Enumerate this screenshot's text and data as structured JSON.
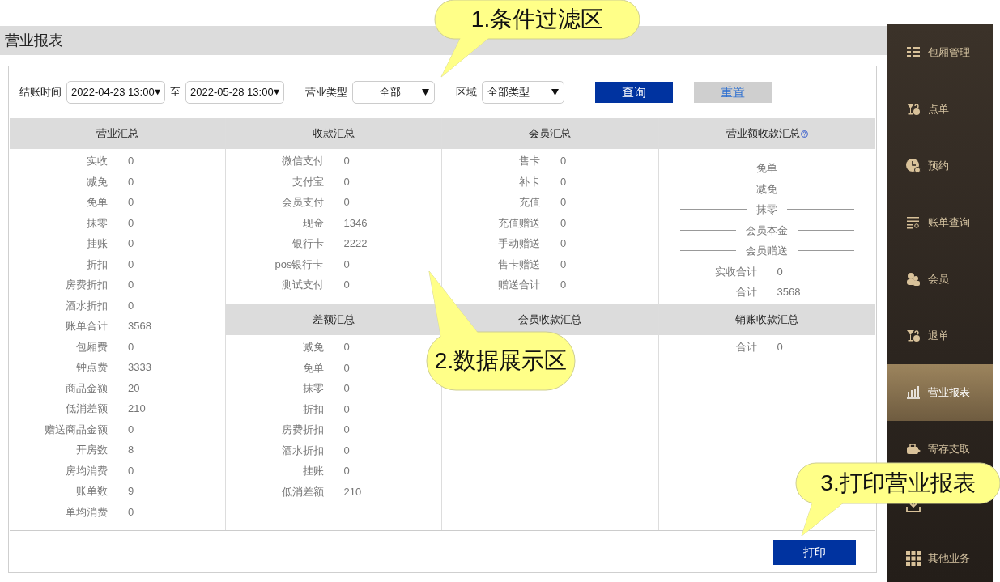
{
  "page_title": "营业报表",
  "filters": {
    "time_label": "结账时间",
    "start": "2022-04-23 13:00",
    "to_label": "至",
    "end": "2022-05-28 13:00",
    "type_label": "营业类型",
    "type_value": "全部",
    "area_label": "区域",
    "area_value": "全部类型",
    "query_button": "查询",
    "reset_button": "重置"
  },
  "summary": {
    "title": "营业汇总",
    "rows": [
      {
        "label": "实收",
        "value": "0"
      },
      {
        "label": "减免",
        "value": "0"
      },
      {
        "label": "免单",
        "value": "0"
      },
      {
        "label": "抹零",
        "value": "0"
      },
      {
        "label": "挂账",
        "value": "0"
      },
      {
        "label": "折扣",
        "value": "0"
      },
      {
        "label": "房费折扣",
        "value": "0"
      },
      {
        "label": "酒水折扣",
        "value": "0"
      },
      {
        "label": "账单合计",
        "value": "3568"
      },
      {
        "label": "包厢费",
        "value": "0"
      },
      {
        "label": "钟点费",
        "value": "3333"
      },
      {
        "label": "商品金额",
        "value": "20"
      },
      {
        "label": "低消差额",
        "value": "210"
      },
      {
        "label": "赠送商品金额",
        "value": "0"
      },
      {
        "label": "开房数",
        "value": "8"
      },
      {
        "label": "房均消费",
        "value": "0"
      },
      {
        "label": "账单数",
        "value": "9"
      },
      {
        "label": "单均消费",
        "value": "0"
      }
    ]
  },
  "upper_panels": [
    {
      "title": "收款汇总",
      "help_icon": false,
      "rows": [
        {
          "kind": "row",
          "label": "微信支付",
          "value": "0"
        },
        {
          "kind": "row",
          "label": "支付宝",
          "value": "0"
        },
        {
          "kind": "row",
          "label": "会员支付",
          "value": "0"
        },
        {
          "kind": "row",
          "label": "现金",
          "value": "1346"
        },
        {
          "kind": "row",
          "label": "银行卡",
          "value": "2222"
        },
        {
          "kind": "row",
          "label": "pos银行卡",
          "value": "0"
        },
        {
          "kind": "row",
          "label": "测试支付",
          "value": "0"
        }
      ]
    },
    {
      "title": "会员汇总",
      "help_icon": false,
      "rows": [
        {
          "kind": "row",
          "label": "售卡",
          "value": "0"
        },
        {
          "kind": "row",
          "label": "补卡",
          "value": "0"
        },
        {
          "kind": "row",
          "label": "充值",
          "value": "0"
        },
        {
          "kind": "row",
          "label": "充值赠送",
          "value": "0"
        },
        {
          "kind": "row",
          "label": "手动赠送",
          "value": "0"
        },
        {
          "kind": "row",
          "label": "售卡赠送",
          "value": "0"
        },
        {
          "kind": "row",
          "label": "赠送合计",
          "value": "0"
        }
      ]
    },
    {
      "title": "营业额收款汇总",
      "help_icon": true,
      "rows": [
        {
          "kind": "divider",
          "label": "免单"
        },
        {
          "kind": "divider",
          "label": "减免"
        },
        {
          "kind": "divider",
          "label": "抹零"
        },
        {
          "kind": "divider",
          "label": "会员本金"
        },
        {
          "kind": "divider",
          "label": "会员赠送"
        },
        {
          "kind": "row",
          "label": "实收合计",
          "value": "0"
        },
        {
          "kind": "row",
          "label": "合计",
          "value": "3568"
        }
      ]
    }
  ],
  "lower_panels": [
    {
      "title": "差额汇总",
      "rows": [
        {
          "label": "减免",
          "value": "0"
        },
        {
          "label": "免单",
          "value": "0"
        },
        {
          "label": "抹零",
          "value": "0"
        },
        {
          "label": "折扣",
          "value": "0"
        },
        {
          "label": "房费折扣",
          "value": "0"
        },
        {
          "label": "酒水折扣",
          "value": "0"
        },
        {
          "label": "挂账",
          "value": "0"
        },
        {
          "label": "低消差额",
          "value": "210"
        }
      ]
    },
    {
      "title": "会员收款汇总"
    },
    {
      "title": "销账收款汇总",
      "rows": [
        {
          "label": "合计",
          "value": "0"
        }
      ]
    }
  ],
  "print_button": "打印",
  "sidebar": [
    {
      "label": "包厢管理",
      "selected": false
    },
    {
      "label": "点单",
      "selected": false
    },
    {
      "label": "预约",
      "selected": false
    },
    {
      "label": "账单查询",
      "selected": false
    },
    {
      "label": "会员",
      "selected": false
    },
    {
      "label": "退单",
      "selected": false
    },
    {
      "label": "营业报表",
      "selected": true
    },
    {
      "label": "寄存支取",
      "selected": false
    },
    {
      "selected": false
    },
    {
      "label": "其他业务",
      "selected": false
    }
  ],
  "callouts": [
    {
      "text": "1.条件过滤区"
    },
    {
      "text": "2.数据展示区"
    },
    {
      "text": "3.打印营业报表"
    }
  ]
}
